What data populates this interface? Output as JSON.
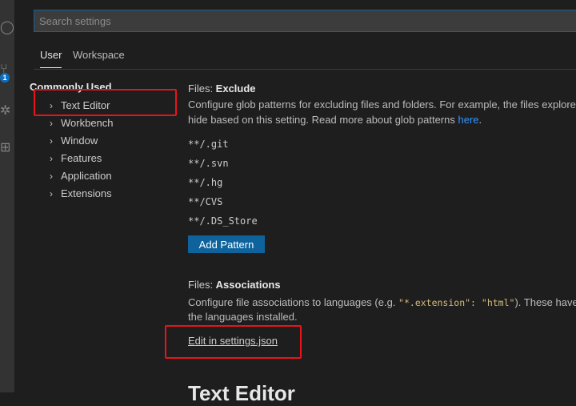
{
  "activity_bar": {
    "badge": "1",
    "icons": [
      "search-icon",
      "source-control-icon",
      "debug-icon",
      "extensions-icon"
    ]
  },
  "search": {
    "placeholder": "Search settings"
  },
  "tabs": [
    {
      "label": "User"
    },
    {
      "label": "Workspace"
    }
  ],
  "toc": {
    "commonly_used": "Commonly Used",
    "items": [
      {
        "label": "Text Editor"
      },
      {
        "label": "Workbench"
      },
      {
        "label": "Window"
      },
      {
        "label": "Features"
      },
      {
        "label": "Application"
      },
      {
        "label": "Extensions"
      }
    ]
  },
  "exclude": {
    "category": "Files: ",
    "name": "Exclude",
    "desc_line1": "Configure glob patterns for excluding files and folders. For example, the files explorer",
    "desc_line2_pre": "hide based on this setting. Read more about glob patterns ",
    "desc_link": "here",
    "desc_line2_post": ".",
    "patterns": [
      "**/.git",
      "**/.svn",
      "**/.hg",
      "**/CVS",
      "**/.DS_Store"
    ],
    "add_button": "Add Pattern"
  },
  "associations": {
    "category": "Files: ",
    "name": "Associations",
    "desc_pre": "Configure file associations to languages (e.g. ",
    "desc_code": "\"*.extension\": \"html\"",
    "desc_post": "). These have",
    "desc_line2": "the languages installed.",
    "edit_link": "Edit in settings.json"
  },
  "next_section": {
    "heading": "Text Editor"
  },
  "colors": {
    "accent": "#0e639c",
    "link": "#3794ff",
    "highlight": "#e8141c",
    "background": "#1e1e1e"
  }
}
